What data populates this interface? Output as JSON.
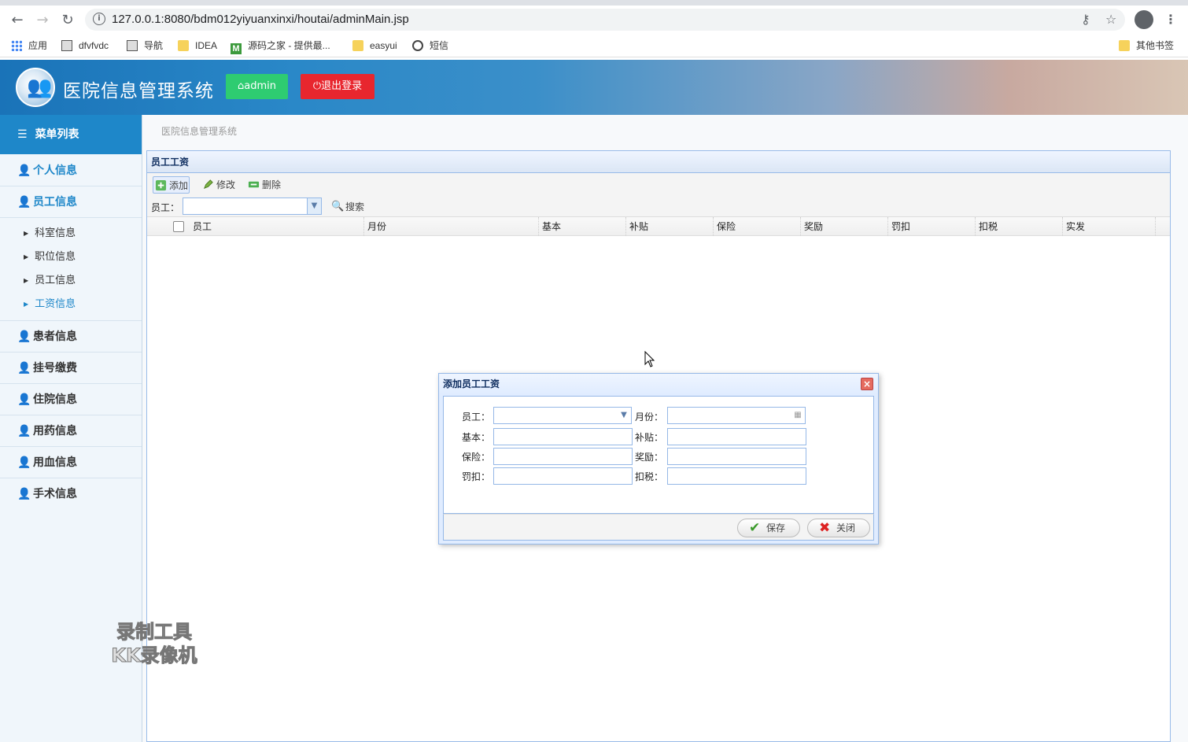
{
  "browser": {
    "url": "127.0.0.1:8080/bdm012yiyuanxinxi/houtai/adminMain.jsp",
    "bookmarks": [
      "应用",
      "dfvfvdc",
      "导航",
      "IDEA",
      "源码之家 - 提供最...",
      "easyui",
      "短信"
    ],
    "other_bookmarks": "其他书签",
    "m_letter": "M"
  },
  "header": {
    "title": "医院信息管理系统",
    "admin_label": "admin",
    "logout_label": "退出登录"
  },
  "sidebar": {
    "heading": "菜单列表",
    "items": [
      "个人信息",
      "员工信息",
      "患者信息",
      "挂号缴费",
      "住院信息",
      "用药信息",
      "用血信息",
      "手术信息"
    ],
    "sub_items": [
      "科室信息",
      "职位信息",
      "员工信息",
      "工资信息"
    ]
  },
  "breadcrumb": "医院信息管理系统",
  "panel": {
    "title": "员工工资",
    "toolbar": {
      "add": "添加",
      "edit": "修改",
      "delete": "删除"
    },
    "search_label": "员工：",
    "search_button": "搜索",
    "columns": [
      "员工",
      "月份",
      "基本",
      "补贴",
      "保险",
      "奖励",
      "罚扣",
      "扣税",
      "实发"
    ]
  },
  "dialog": {
    "title": "添加员工工资",
    "fields": {
      "employee": "员工：",
      "month": "月份：",
      "base": "基本：",
      "allowance": "补贴：",
      "insurance": "保险：",
      "bonus": "奖励：",
      "penalty": "罚扣：",
      "tax": "扣税："
    },
    "save": "保存",
    "close": "关闭"
  },
  "watermark": [
    "录制工具",
    "KK录像机"
  ]
}
